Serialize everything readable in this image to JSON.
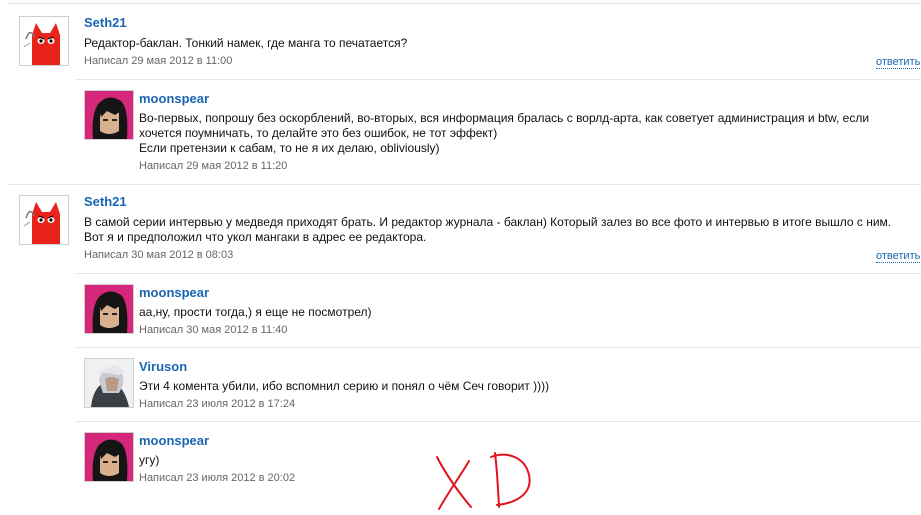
{
  "comments": [
    {
      "author": "Seth21",
      "avatar": "red-cat-avatar",
      "lines": [
        "Редактор-баклан. Тонкий намек, где манга то печатается?"
      ],
      "meta": "Написал 29 мая 2012 в 11:00",
      "reply": "ответить"
    },
    {
      "author": "moonspear",
      "avatar": "dark-haired-character-avatar",
      "lines": [
        "Во-первых, попрошу без оскорблений, во-вторых, вся информация бралась с ворлд-арта, как советует администрация и btw, если",
        "хочется поумничать, то делайте это без ошибок, не тот эффект)",
        "Если претензии к сабам, то не я их делаю, obliviously)"
      ],
      "meta": "Написал 29 мая 2012 в 11:20"
    },
    {
      "author": "Seth21",
      "avatar": "red-cat-avatar",
      "lines": [
        "В самой серии интервью у медведя приходят брать. И редактор журнала - баклан) Который залез во все фото и интервью в итоге вышло с  ним.",
        "Вот я и предположил что укол мангаки в адрес ее редактора."
      ],
      "meta": "Написал 30 мая 2012 в 08:03",
      "reply": "ответить"
    },
    {
      "author": "moonspear",
      "avatar": "dark-haired-character-avatar",
      "lines": [
        "аа,ну, прости тогда,) я еще не посмотрел)"
      ],
      "meta": "Написал 30 мая 2012 в 11:40"
    },
    {
      "author": "Viruson",
      "avatar": "white-haired-character-avatar",
      "lines": [
        "Эти 4 комента убили, ибо вспомнил серию и понял о чём Сеч говорит ))))"
      ],
      "meta": "Написал 23 июля 2012 в 17:24"
    },
    {
      "author": "moonspear",
      "avatar": "dark-haired-character-avatar",
      "lines": [
        "угу)"
      ],
      "meta": "Написал 23 июля 2012 в 20:02"
    }
  ],
  "annotation": {
    "text": "XD",
    "color": "#e0141e"
  },
  "colors": {
    "link": "#1a66b3",
    "meta": "#666666",
    "separator": "#e6e6e6"
  }
}
